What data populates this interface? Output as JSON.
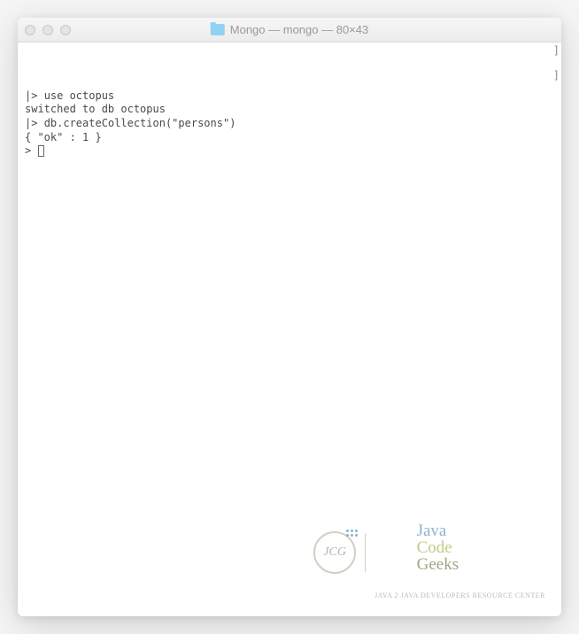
{
  "window": {
    "title": "Mongo — mongo — 80×43"
  },
  "terminal": {
    "lines": [
      {
        "prompt": "|> ",
        "text": "use octopus"
      },
      {
        "prompt": "",
        "text": "switched to db octopus"
      },
      {
        "prompt": "|> ",
        "text": "db.createCollection(\"persons\")"
      },
      {
        "prompt": "",
        "text": "{ \"ok\" : 1 }"
      },
      {
        "prompt": "> ",
        "text": "",
        "cursor": true
      }
    ]
  },
  "watermark": {
    "circle_text": "JCG",
    "word1": "Java",
    "word2": "Code",
    "word3": "Geeks",
    "subtitle": "JAVA 2 JAVA DEVELOPERS RESOURCE CENTER"
  }
}
